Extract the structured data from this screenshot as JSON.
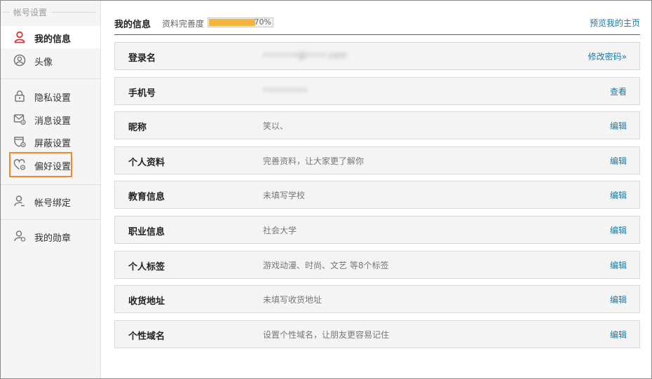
{
  "sidebar": {
    "title": "帐号设置",
    "items": [
      {
        "label": "我的信息"
      },
      {
        "label": "头像"
      },
      {
        "label": "隐私设置"
      },
      {
        "label": "消息设置"
      },
      {
        "label": "屏蔽设置"
      },
      {
        "label": "偏好设置"
      },
      {
        "label": "帐号绑定"
      },
      {
        "label": "我的勋章"
      }
    ]
  },
  "header": {
    "title": "我的信息",
    "completeness_label": "资料完善度",
    "completeness_value": 0.7,
    "completeness_text": "70%",
    "preview_link": "预览我的主页"
  },
  "rows": [
    {
      "key": "登录名",
      "value": "•••••••@••••.com",
      "action": "修改密码»"
    },
    {
      "key": "手机号",
      "value": "•••••••••",
      "action": "查看"
    },
    {
      "key": "昵称",
      "value": "笑以、",
      "action": "编辑"
    },
    {
      "key": "个人资料",
      "value": "完善资料，让大家更了解你",
      "action": "编辑"
    },
    {
      "key": "教育信息",
      "value": "未填写学校",
      "action": "编辑"
    },
    {
      "key": "职业信息",
      "value": "社会大学",
      "action": "编辑"
    },
    {
      "key": "个人标签",
      "value": "游戏动漫、时尚、文艺 等8个标签",
      "action": "编辑"
    },
    {
      "key": "收货地址",
      "value": "未填写收货地址",
      "action": "编辑"
    },
    {
      "key": "个性域名",
      "value": "设置个性域名，让朋友更容易记住",
      "action": "编辑"
    }
  ],
  "colors": {
    "accent_red": "#c62f2f",
    "link_blue": "#1a7aa5",
    "progress_fill": "#f4b53e",
    "highlight_orange": "#f0892b"
  }
}
